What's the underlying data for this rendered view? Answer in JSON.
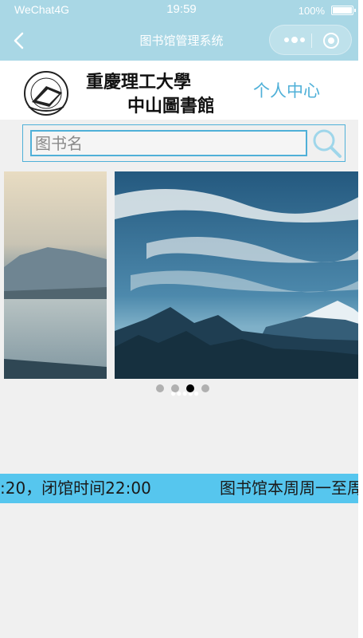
{
  "status_bar": {
    "signal_dots": "●●●●●",
    "carrier": "WeChat4G",
    "time": "19:59",
    "battery": "100%"
  },
  "nav": {
    "title": "图书馆管理系统",
    "back_icon": "chevron-left-icon",
    "more_icon": "more-dots-icon",
    "close_icon": "target-close-icon"
  },
  "header": {
    "logo_text_line1": "重慶理工大學",
    "logo_text_line2": "中山圖書館",
    "personal_center": "个人中心"
  },
  "search": {
    "placeholder": "图书名",
    "value": "",
    "icon": "search-icon"
  },
  "carousel": {
    "slide_count": 4,
    "active_index": 2
  },
  "notice": {
    "visible_end": ":20，闭馆时间22:00",
    "visible_start": "图书馆本周周一至周"
  },
  "colors": {
    "nav_bg": "#a9d7e5",
    "accent": "#4fb0d8",
    "ticker_bg": "#56c6ee",
    "page_bg": "#f0f0f0"
  }
}
